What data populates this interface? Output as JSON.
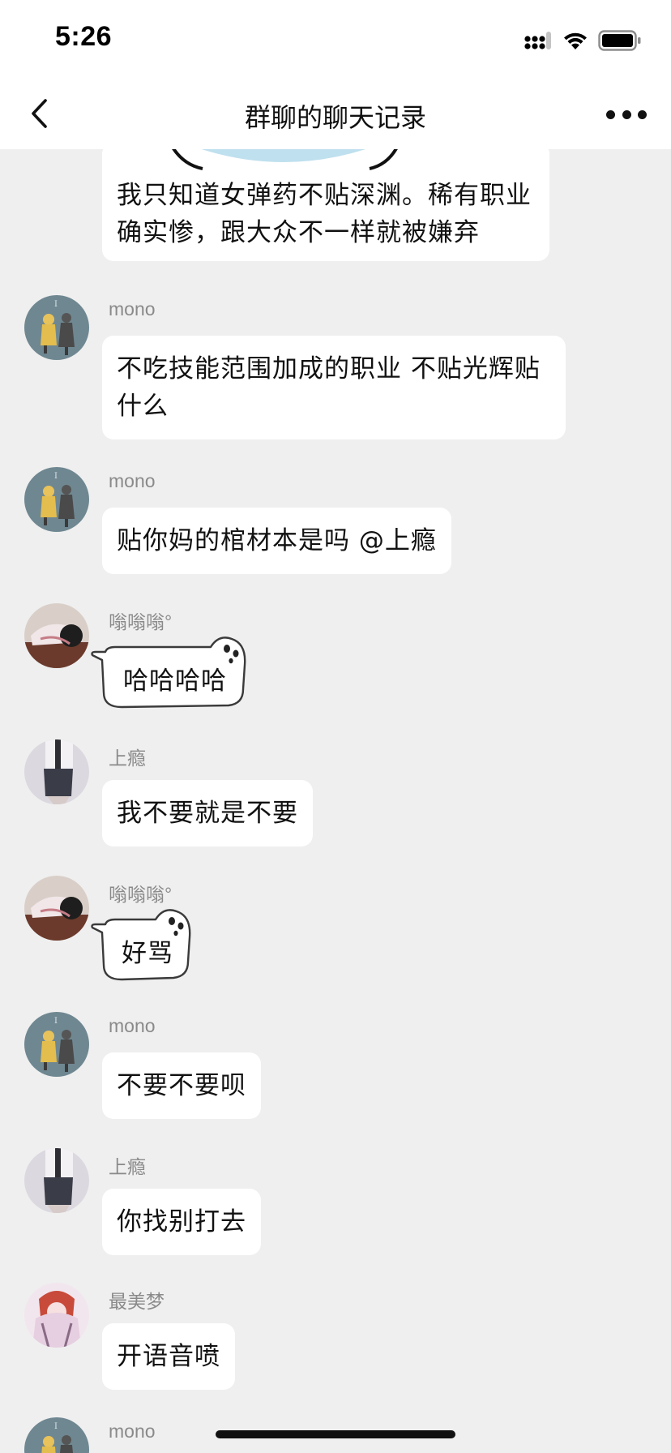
{
  "status": {
    "time": "5:26"
  },
  "nav": {
    "title": "群聊的聊天记录"
  },
  "messages": [
    {
      "text": "我只知道女弹药不贴深渊。稀有职业确实惨，跟大众不一样就被嫌弃"
    },
    {
      "sender": "mono",
      "text": "不吃技能范围加成的职业 不贴光辉贴什么"
    },
    {
      "sender": "mono",
      "text": "贴你妈的棺材本是吗 @上瘾"
    },
    {
      "sender": "嗡嗡嗡°",
      "text": "哈哈哈哈"
    },
    {
      "sender": "上瘾",
      "text": "我不要就是不要"
    },
    {
      "sender": "嗡嗡嗡°",
      "text": "好骂"
    },
    {
      "sender": "mono",
      "text": "不要不要呗"
    },
    {
      "sender": "上瘾",
      "text": "你找别打去"
    },
    {
      "sender": "最美梦",
      "text": "开语音喷"
    },
    {
      "sender": "mono"
    }
  ],
  "colors": {
    "background": "#efefef",
    "bubble": "#ffffff",
    "sender_name": "#8a8a8a",
    "bar": "#ffffff"
  },
  "icons": [
    "signal-icon",
    "wifi-icon",
    "battery-icon",
    "back-chevron-icon",
    "more-dots-icon"
  ]
}
